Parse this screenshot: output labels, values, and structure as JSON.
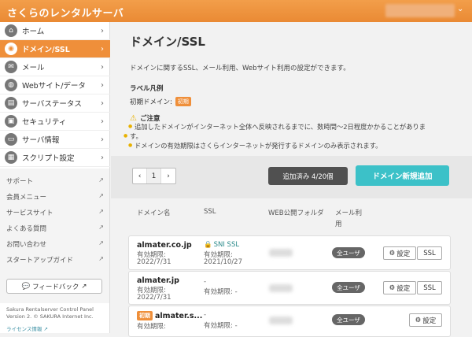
{
  "app": {
    "title": "さくらのレンタルサーバ"
  },
  "sidebar": {
    "items": [
      {
        "label": "ホーム",
        "icon": "home-icon",
        "glyph": "⌂"
      },
      {
        "label": "ドメイン/SSL",
        "icon": "domain-icon",
        "glyph": "◉",
        "active": true
      },
      {
        "label": "メール",
        "icon": "mail-icon",
        "glyph": "✉"
      },
      {
        "label": "Webサイト/データ",
        "icon": "globe-icon",
        "glyph": "◍"
      },
      {
        "label": "サーバステータス",
        "icon": "chart-icon",
        "glyph": "▤"
      },
      {
        "label": "セキュリティ",
        "icon": "lock-icon",
        "glyph": "🔒"
      },
      {
        "label": "サーバ情報",
        "icon": "server-icon",
        "glyph": "▭"
      },
      {
        "label": "スクリプト設定",
        "icon": "script-icon",
        "glyph": "▦"
      }
    ],
    "links": [
      "サポート",
      "会員メニュー",
      "サービスサイト",
      "よくある質問",
      "お問い合わせ",
      "スタートアップガイド"
    ],
    "feedback_label": "フィードバック",
    "footer_line1": "Sakura Rentalserver Control Panel",
    "footer_line2": "Version 2. © SAKURA Internet Inc.",
    "footer_line3": "ライセンス情報"
  },
  "main": {
    "title": "ドメイン/SSL",
    "description": "ドメインに関するSSL、メール利用、Webサイト利用の設定ができます。",
    "legend_title": "ラベル凡例",
    "legend_label": "初期ドメイン:",
    "legend_badge": "初期",
    "notice_title": "ご注意",
    "notice_1": "追加したドメインがインターネット全体へ反映されるまでに、数時間〜2日程度かかることがありま",
    "notice_1b": "す。",
    "notice_2": "ドメインの有効期限はさくらインターネットが発行するドメインのみ表示されます。"
  },
  "toolbar": {
    "prev": "‹",
    "page": "1",
    "next": "›",
    "added_label": "追加済み 4/20個",
    "new_label": "ドメイン新規追加"
  },
  "table": {
    "headers": {
      "domain": "ドメイン名",
      "ssl": "SSL",
      "folder": "WEB公開フォルダ",
      "mail": "メール利",
      "mail2": "用"
    },
    "rows": [
      {
        "domain": "almater.co.jp",
        "exp_label": "有効期限:",
        "exp": "2022/7/31",
        "ssl": "SNI SSL",
        "ssl_exp_label": "有効期限:",
        "ssl_exp": "2021/10/27",
        "mail": "全ユーザ",
        "setting": "設定",
        "ssl_btn": "SSL"
      },
      {
        "domain": "almater.jp",
        "exp_label": "有効期限:",
        "exp": "2022/7/31",
        "ssl": "-",
        "ssl_exp_label": "有効期限: -",
        "mail": "全ユーザ",
        "setting": "設定",
        "ssl_btn": "SSL"
      },
      {
        "domain": "almater.s...",
        "badge": "初期",
        "exp_label": "有効期限:",
        "ssl": "-",
        "ssl_exp_label": "有効期限: -",
        "mail": "全ユーザ",
        "setting": "設定"
      }
    ]
  }
}
